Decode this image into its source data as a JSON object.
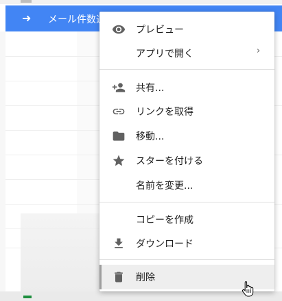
{
  "background": {
    "selected_file_name": "メール件数通",
    "selected_file_icon": "arrow-right-icon",
    "highlight_color": "#4285f4"
  },
  "context_menu": {
    "items": [
      {
        "label": "プレビュー",
        "icon": "eye-icon"
      },
      {
        "label": "アプリで開く",
        "icon": "",
        "submenu": "›"
      },
      {
        "label": "共有...",
        "icon": "person-add-icon"
      },
      {
        "label": "リンクを取得",
        "icon": "link-icon"
      },
      {
        "label": "移動...",
        "icon": "folder-icon"
      },
      {
        "label": "スターを付ける",
        "icon": "star-icon"
      },
      {
        "label": "名前を変更...",
        "icon": ""
      },
      {
        "label": "コピーを作成",
        "icon": ""
      },
      {
        "label": "ダウンロード",
        "icon": "download-icon"
      },
      {
        "label": "削除",
        "icon": "trash-icon"
      }
    ],
    "hovered_item": "削除",
    "icon_color": "#616161"
  },
  "pointer": {
    "icon": "hand-pointer-icon"
  }
}
